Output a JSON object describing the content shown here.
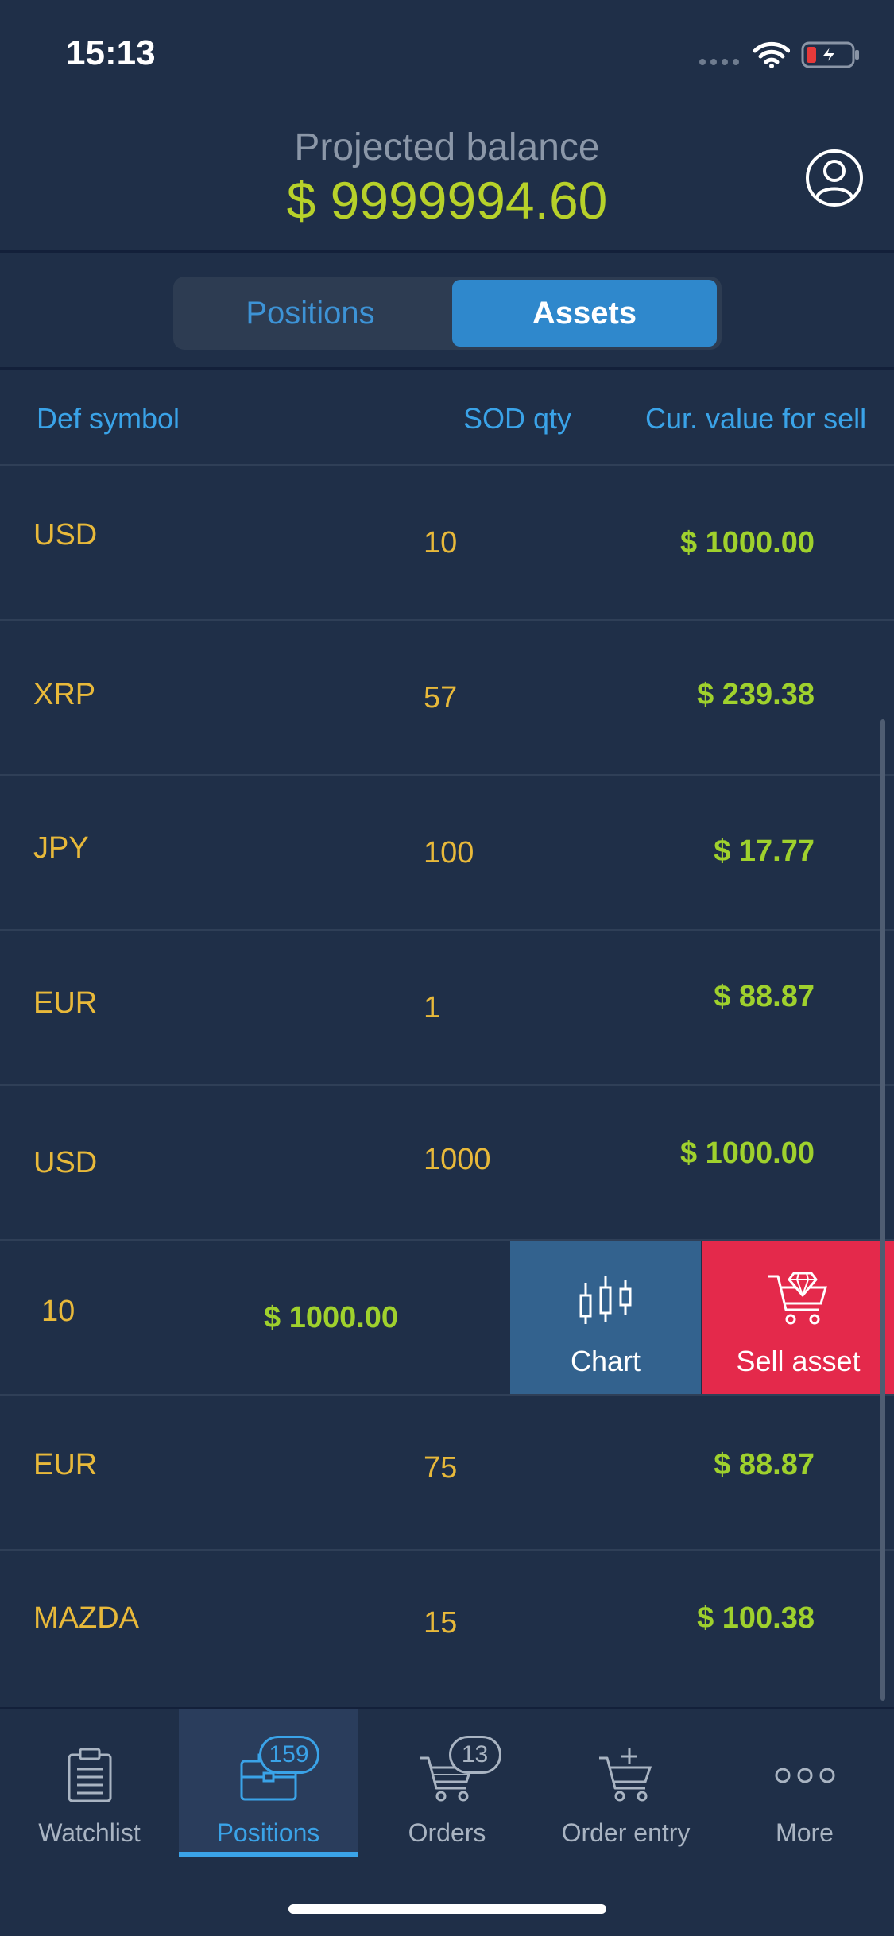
{
  "status_bar": {
    "time": "15:13"
  },
  "header": {
    "balance_label": "Projected balance",
    "balance_value": "$ 9999994.60"
  },
  "segmented": {
    "positions": "Positions",
    "assets": "Assets",
    "selected": "Assets"
  },
  "columns": {
    "symbol": "Def symbol",
    "qty": "SOD qty",
    "value": "Cur. value for sell"
  },
  "rows": [
    {
      "symbol": "USD",
      "qty": "10",
      "value": "$ 1000.00"
    },
    {
      "symbol": "XRP",
      "qty": "57",
      "value": "$ 239.38"
    },
    {
      "symbol": "JPY",
      "qty": "100",
      "value": "$ 17.77"
    },
    {
      "symbol": "EUR",
      "qty": "1",
      "value": "$ 88.87"
    },
    {
      "symbol": "USD",
      "qty": "1000",
      "value": "$ 1000.00"
    },
    {
      "symbol": "",
      "qty": "10",
      "value": "$ 1000.00"
    },
    {
      "symbol": "EUR",
      "qty": "75",
      "value": "$ 88.87"
    },
    {
      "symbol": "MAZDA",
      "qty": "15",
      "value": "$ 100.38"
    }
  ],
  "swipe_actions": {
    "chart": "Chart",
    "sell": "Sell asset"
  },
  "tabbar": {
    "watchlist": "Watchlist",
    "positions": "Positions",
    "positions_badge": "159",
    "orders": "Orders",
    "orders_badge": "13",
    "order_entry": "Order entry",
    "more": "More"
  },
  "colors": {
    "background": "#1f2f48",
    "accent": "#3aa3e8",
    "gain": "#9fd12d",
    "symbol": "#e8b93a",
    "sell": "#e4294b",
    "chart": "#33628e"
  },
  "icons": [
    "wifi-icon",
    "battery-charging-icon",
    "profile-icon",
    "candlestick-icon",
    "diamond-cart-icon",
    "clipboard-icon",
    "briefcase-icon",
    "cart-icon",
    "cart-plus-icon",
    "more-dots-icon"
  ]
}
